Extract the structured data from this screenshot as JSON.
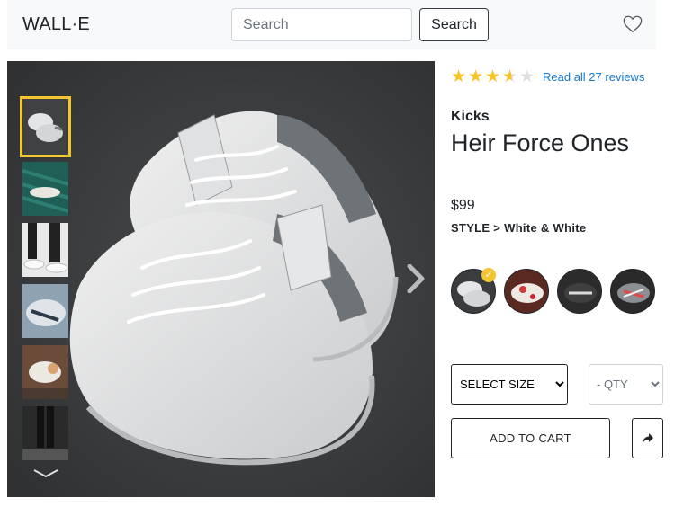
{
  "navbar": {
    "brand": "WALL·E",
    "search_placeholder": "Search",
    "search_button": "Search",
    "wishlist_icon": "heart-outline-icon"
  },
  "gallery": {
    "main_image": "white-sneakers-photo",
    "thumbnails": [
      {
        "name": "white sneakers pair",
        "selected": true
      },
      {
        "name": "sneakers on green",
        "selected": false
      },
      {
        "name": "legs with sneakers",
        "selected": false
      },
      {
        "name": "sneaker close-up",
        "selected": false
      },
      {
        "name": "hands holding sneakers",
        "selected": false
      },
      {
        "name": "person standing",
        "selected": false
      }
    ],
    "next_icon": "chevron-right-icon",
    "thumbs_down_icon": "chevron-down-icon",
    "highlight_color": "#f5c431"
  },
  "product": {
    "rating": 3.5,
    "rating_max": 5,
    "reviews_link": "Read all 27 reviews",
    "brand": "Kicks",
    "name": "Heir Force Ones",
    "price": "$99",
    "style_label": "STYLE >",
    "style_value": "White & White",
    "styles": [
      {
        "name": "white-white",
        "selected": true
      },
      {
        "name": "white-red",
        "selected": false
      },
      {
        "name": "black-white",
        "selected": false
      },
      {
        "name": "grey-red",
        "selected": false
      }
    ],
    "size_select": "SELECT SIZE",
    "qty_select": "- QTY",
    "add_to_cart": "ADD TO CART",
    "share_icon": "share-arrow-icon"
  },
  "colors": {
    "star": "#f7c325",
    "link": "#1479d2",
    "navbar_bg": "#f8f9fa"
  }
}
